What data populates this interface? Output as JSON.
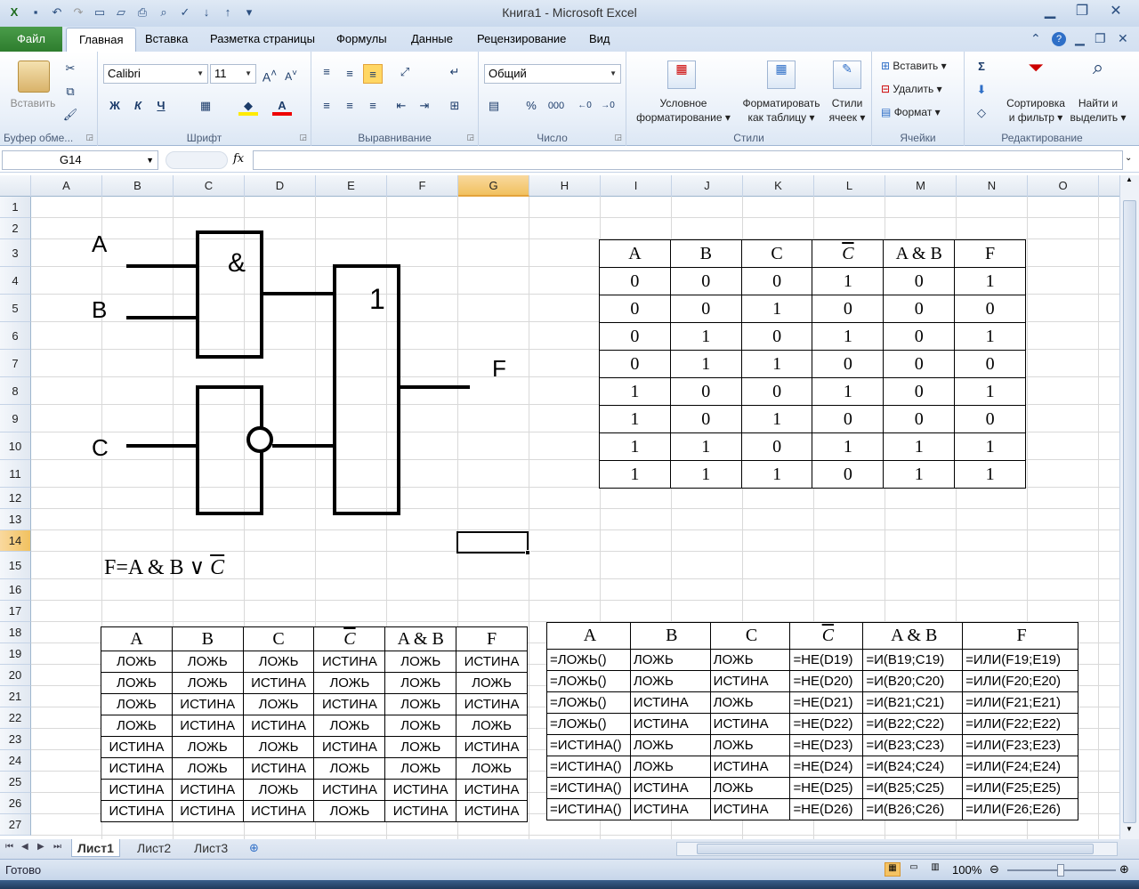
{
  "window": {
    "title": "Книга1  -  Microsoft Excel"
  },
  "tabs": {
    "file": "Файл",
    "items": [
      "Главная",
      "Вставка",
      "Разметка страницы",
      "Формулы",
      "Данные",
      "Рецензирование",
      "Вид"
    ]
  },
  "ribbon": {
    "clipboard": {
      "label": "Буфер обме...",
      "paste": "Вставить"
    },
    "font": {
      "label": "Шрифт",
      "name": "Calibri",
      "size": "11",
      "bold": "Ж",
      "italic": "К",
      "underline": "Ч"
    },
    "alignment": {
      "label": "Выравнивание"
    },
    "number": {
      "label": "Число",
      "format": "Общий",
      "percent": "%",
      "thousands": "000"
    },
    "styles": {
      "label": "Стили",
      "conditional": [
        "Условное",
        "форматирование"
      ],
      "as_table": [
        "Форматировать",
        "как таблицу"
      ],
      "cell_styles": [
        "Стили",
        "ячеек"
      ]
    },
    "cells": {
      "label": "Ячейки",
      "insert": "Вставить",
      "delete": "Удалить",
      "format": "Формат"
    },
    "editing": {
      "label": "Редактирование",
      "sort": [
        "Сортировка",
        "и фильтр"
      ],
      "find": [
        "Найти и",
        "выделить"
      ]
    }
  },
  "formula_bar": {
    "namebox": "G14",
    "fx": "fx",
    "value": ""
  },
  "columns": [
    "A",
    "B",
    "C",
    "D",
    "E",
    "F",
    "G",
    "H",
    "I",
    "J",
    "K",
    "L",
    "M",
    "N",
    "O"
  ],
  "rows": [
    "1",
    "2",
    "3",
    "4",
    "5",
    "6",
    "7",
    "8",
    "9",
    "10",
    "11",
    "12",
    "13",
    "14",
    "15",
    "16",
    "17",
    "18",
    "19",
    "20",
    "21",
    "22",
    "23",
    "24",
    "25",
    "26",
    "27"
  ],
  "diagram": {
    "input_a": "A",
    "input_b": "B",
    "input_c": "C",
    "and_gate": "&",
    "or_gate": "1",
    "output": "F"
  },
  "formula_text": {
    "lhs": "F=A & B ∨ ",
    "c": "C"
  },
  "truth_table": {
    "header": [
      "A",
      "B",
      "C",
      "C",
      "A & B",
      "F"
    ],
    "rows": [
      [
        "0",
        "0",
        "0",
        "1",
        "0",
        "1"
      ],
      [
        "0",
        "0",
        "1",
        "0",
        "0",
        "0"
      ],
      [
        "0",
        "1",
        "0",
        "1",
        "0",
        "1"
      ],
      [
        "0",
        "1",
        "1",
        "0",
        "0",
        "0"
      ],
      [
        "1",
        "0",
        "0",
        "1",
        "0",
        "1"
      ],
      [
        "1",
        "0",
        "1",
        "0",
        "0",
        "0"
      ],
      [
        "1",
        "1",
        "0",
        "1",
        "1",
        "1"
      ],
      [
        "1",
        "1",
        "1",
        "0",
        "1",
        "1"
      ]
    ]
  },
  "bool_table": {
    "header": [
      "A",
      "B",
      "C",
      "C",
      "A & B",
      "F"
    ],
    "rows": [
      [
        "ЛОЖЬ",
        "ЛОЖЬ",
        "ЛОЖЬ",
        "ИСТИНА",
        "ЛОЖЬ",
        "ИСТИНА"
      ],
      [
        "ЛОЖЬ",
        "ЛОЖЬ",
        "ИСТИНА",
        "ЛОЖЬ",
        "ЛОЖЬ",
        "ЛОЖЬ"
      ],
      [
        "ЛОЖЬ",
        "ИСТИНА",
        "ЛОЖЬ",
        "ИСТИНА",
        "ЛОЖЬ",
        "ИСТИНА"
      ],
      [
        "ЛОЖЬ",
        "ИСТИНА",
        "ИСТИНА",
        "ЛОЖЬ",
        "ЛОЖЬ",
        "ЛОЖЬ"
      ],
      [
        "ИСТИНА",
        "ЛОЖЬ",
        "ЛОЖЬ",
        "ИСТИНА",
        "ЛОЖЬ",
        "ИСТИНА"
      ],
      [
        "ИСТИНА",
        "ЛОЖЬ",
        "ИСТИНА",
        "ЛОЖЬ",
        "ЛОЖЬ",
        "ЛОЖЬ"
      ],
      [
        "ИСТИНА",
        "ИСТИНА",
        "ЛОЖЬ",
        "ИСТИНА",
        "ИСТИНА",
        "ИСТИНА"
      ],
      [
        "ИСТИНА",
        "ИСТИНА",
        "ИСТИНА",
        "ЛОЖЬ",
        "ИСТИНА",
        "ИСТИНА"
      ]
    ]
  },
  "formula_table": {
    "header": [
      "A",
      "B",
      "C",
      "C",
      "A & B",
      "F"
    ],
    "rows": [
      [
        "=ЛОЖЬ()",
        "ЛОЖЬ",
        "ЛОЖЬ",
        "=НЕ(D19)",
        "=И(B19;C19)",
        "=ИЛИ(F19;E19)"
      ],
      [
        "=ЛОЖЬ()",
        "ЛОЖЬ",
        "ИСТИНА",
        "=НЕ(D20)",
        "=И(B20;C20)",
        "=ИЛИ(F20;E20)"
      ],
      [
        "=ЛОЖЬ()",
        "ИСТИНА",
        "ЛОЖЬ",
        "=НЕ(D21)",
        "=И(B21;C21)",
        "=ИЛИ(F21;E21)"
      ],
      [
        "=ЛОЖЬ()",
        "ИСТИНА",
        "ИСТИНА",
        "=НЕ(D22)",
        "=И(B22;C22)",
        "=ИЛИ(F22;E22)"
      ],
      [
        "=ИСТИНА()",
        "ЛОЖЬ",
        "ЛОЖЬ",
        "=НЕ(D23)",
        "=И(B23;C23)",
        "=ИЛИ(F23;E23)"
      ],
      [
        "=ИСТИНА()",
        "ЛОЖЬ",
        "ИСТИНА",
        "=НЕ(D24)",
        "=И(B24;C24)",
        "=ИЛИ(F24;E24)"
      ],
      [
        "=ИСТИНА()",
        "ИСТИНА",
        "ЛОЖЬ",
        "=НЕ(D25)",
        "=И(B25;C25)",
        "=ИЛИ(F25;E25)"
      ],
      [
        "=ИСТИНА()",
        "ИСТИНА",
        "ИСТИНА",
        "=НЕ(D26)",
        "=И(B26;C26)",
        "=ИЛИ(F26;E26)"
      ]
    ]
  },
  "sheets": [
    "Лист1",
    "Лист2",
    "Лист3"
  ],
  "status": {
    "ready": "Готово",
    "zoom": "100%"
  }
}
